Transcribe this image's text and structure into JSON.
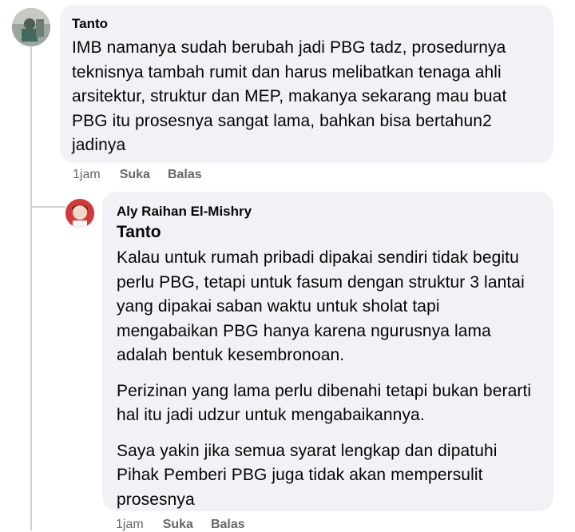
{
  "comment": {
    "author": "Tanto",
    "text": "IMB namanya sudah berubah jadi PBG tadz, prosedurnya teknisnya tambah rumit dan harus melibatkan tenaga ahli arsitektur, struktur dan MEP, makanya sekarang mau buat PBG itu prosesnya sangat lama, bahkan bisa bertahun2 jadinya",
    "time": "1jam",
    "like_label": "Suka",
    "reply_label": "Balas"
  },
  "reply": {
    "author": "Aly Raihan El-Mishry",
    "mention": "Tanto",
    "paragraphs": [
      "Kalau untuk rumah pribadi dipakai sendiri tidak begitu perlu PBG, tetapi untuk fasum dengan struktur 3 lantai yang dipakai saban waktu untuk sholat tapi mengabaikan PBG hanya karena ngurusnya lama adalah bentuk kesembronoan.",
      "Perizinan yang lama perlu dibenahi tetapi bukan berarti hal itu jadi udzur untuk mengabaikannya.",
      "Saya yakin jika semua syarat lengkap dan dipatuhi Pihak Pemberi PBG juga tidak akan mempersulit prosesnya"
    ],
    "time": "1jam",
    "like_label": "Suka",
    "reply_label": "Balas"
  },
  "colors": {
    "bubble": "#f0f2f5",
    "meta_text": "#65676b",
    "thread_line": "#ced0d4"
  }
}
